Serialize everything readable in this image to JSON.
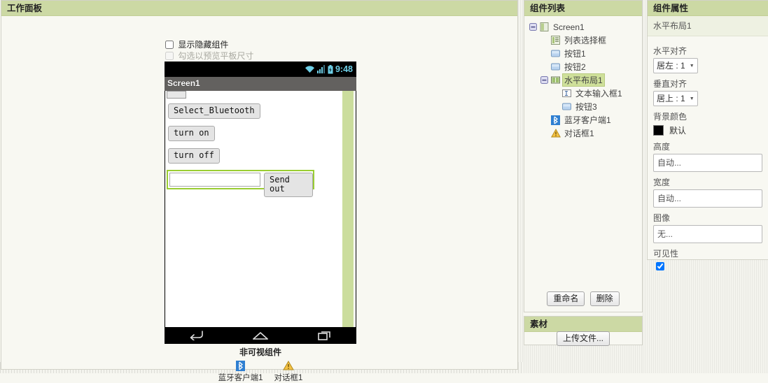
{
  "viewer": {
    "title": "工作面板",
    "checkboxes": [
      {
        "label": "显示隐藏组件",
        "checked": false,
        "disabled": false
      },
      {
        "label": "勾选以预览平板尺寸",
        "checked": false,
        "disabled": true
      }
    ],
    "phone": {
      "statusbar": {
        "time": "9:48",
        "icons": [
          "wifi-icon",
          "signal-icon",
          "battery-icon"
        ]
      },
      "title": "Screen1",
      "listpicker_text": "",
      "buttons": [
        {
          "label": "Select_Bluetooth"
        },
        {
          "label": "turn on"
        },
        {
          "label": "turn off"
        }
      ],
      "arrangement": {
        "textbox_value": "",
        "send_label": "Send out",
        "selected": true,
        "selection_color": "#9acd32"
      },
      "navbar": [
        "back-icon",
        "home-icon",
        "recents-icon"
      ]
    },
    "nonvisible": {
      "title": "非可视组件",
      "items": [
        {
          "label": "蓝牙客户端1",
          "icon": "bluetooth-icon"
        },
        {
          "label": "对话框1",
          "icon": "notifier-warning-icon"
        }
      ]
    }
  },
  "tree": {
    "title": "组件列表",
    "nodes": [
      {
        "label": "Screen1",
        "icon": "screen-icon",
        "depth": 0,
        "expander": "minus",
        "selected": false
      },
      {
        "label": "列表选择框",
        "icon": "listpicker-icon",
        "depth": 1,
        "expander": "",
        "selected": false
      },
      {
        "label": "按钮1",
        "icon": "button-icon",
        "depth": 1,
        "expander": "",
        "selected": false
      },
      {
        "label": "按钮2",
        "icon": "button-icon",
        "depth": 1,
        "expander": "",
        "selected": false
      },
      {
        "label": "水平布局1",
        "icon": "harrangement-icon",
        "depth": 1,
        "expander": "minus",
        "selected": true
      },
      {
        "label": "文本输入框1",
        "icon": "textbox-icon",
        "depth": 2,
        "expander": "",
        "selected": false
      },
      {
        "label": "按钮3",
        "icon": "button-icon",
        "depth": 2,
        "expander": "",
        "selected": false
      },
      {
        "label": "蓝牙客户端1",
        "icon": "bluetooth-icon",
        "depth": 1,
        "expander": "",
        "selected": false
      },
      {
        "label": "对话框1",
        "icon": "notifier-warning-icon",
        "depth": 1,
        "expander": "",
        "selected": false
      }
    ],
    "rename_label": "重命名",
    "delete_label": "删除"
  },
  "media": {
    "title": "素材",
    "upload_label": "上传文件..."
  },
  "properties": {
    "title": "组件属性",
    "component": "水平布局1",
    "fields": [
      {
        "label": "水平对齐",
        "type": "select",
        "value": "居左 : 1"
      },
      {
        "label": "垂直对齐",
        "type": "select",
        "value": "居上 : 1"
      },
      {
        "label": "背景颜色",
        "type": "color",
        "value": "默认",
        "swatch": "#000000"
      },
      {
        "label": "高度",
        "type": "text",
        "value": "自动..."
      },
      {
        "label": "宽度",
        "type": "text",
        "value": "自动..."
      },
      {
        "label": "图像",
        "type": "text",
        "value": "无..."
      },
      {
        "label": "可见性",
        "type": "checkbox",
        "checked": true
      }
    ]
  },
  "colors": {
    "header_green": "#ccd9a4",
    "selection_green": "#cfe09a",
    "panel_bg": "#f8f8f2",
    "status_cyan": "#6fd0e8"
  }
}
